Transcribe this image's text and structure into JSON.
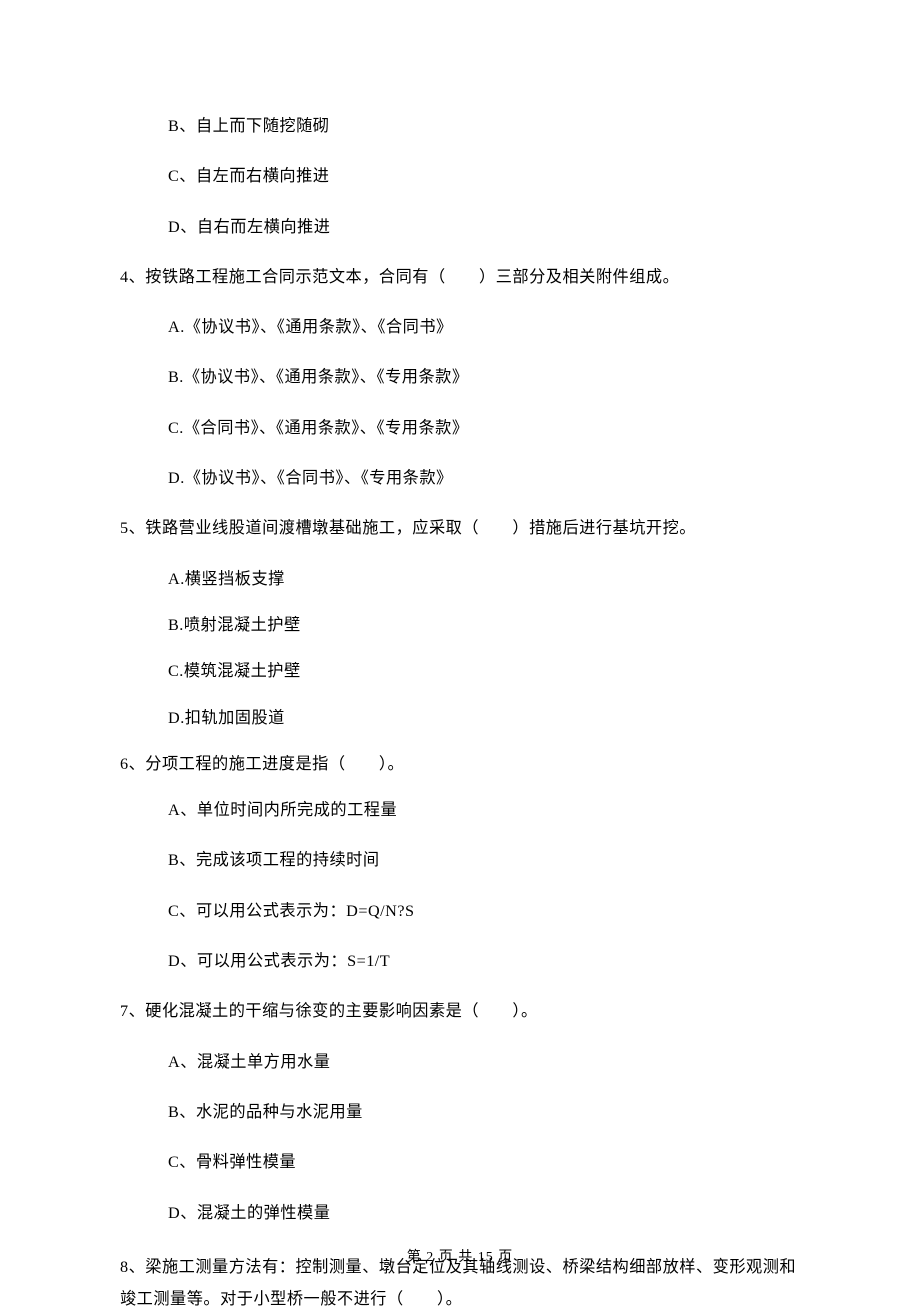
{
  "options_pre": [
    "B、自上而下随挖随砌",
    "C、自左而右横向推进",
    "D、自右而左横向推进"
  ],
  "q4": {
    "text": "4、按铁路工程施工合同示范文本，合同有（　　）三部分及相关附件组成。",
    "options": [
      "A.《协议书》、《通用条款》、《合同书》",
      "B.《协议书》、《通用条款》、《专用条款》",
      "C.《合同书》、《通用条款》、《专用条款》",
      "D.《协议书》、《合同书》、《专用条款》"
    ]
  },
  "q5": {
    "text": "5、铁路营业线股道间渡槽墩基础施工，应采取（　　）措施后进行基坑开挖。",
    "options": [
      "A.横竖挡板支撑",
      "B.喷射混凝土护壁",
      "C.模筑混凝土护壁",
      "D.扣轨加固股道"
    ]
  },
  "q6": {
    "text": "6、分项工程的施工进度是指（　　）。",
    "options": [
      "A、单位时间内所完成的工程量",
      "B、完成该项工程的持续时间",
      "C、可以用公式表示为：D=Q/N?S",
      "D、可以用公式表示为：S=1/T"
    ]
  },
  "q7": {
    "text": "7、硬化混凝土的干缩与徐变的主要影响因素是（　　）。",
    "options": [
      "A、混凝土单方用水量",
      "B、水泥的品种与水泥用量",
      "C、骨料弹性模量",
      "D、混凝土的弹性模量"
    ]
  },
  "q8": {
    "text": "8、梁施工测量方法有：控制测量、墩台定位及其轴线测设、桥梁结构细部放样、变形观测和竣工测量等。对于小型桥一般不进行（　　）。"
  },
  "footer": "第 2 页 共 15 页"
}
